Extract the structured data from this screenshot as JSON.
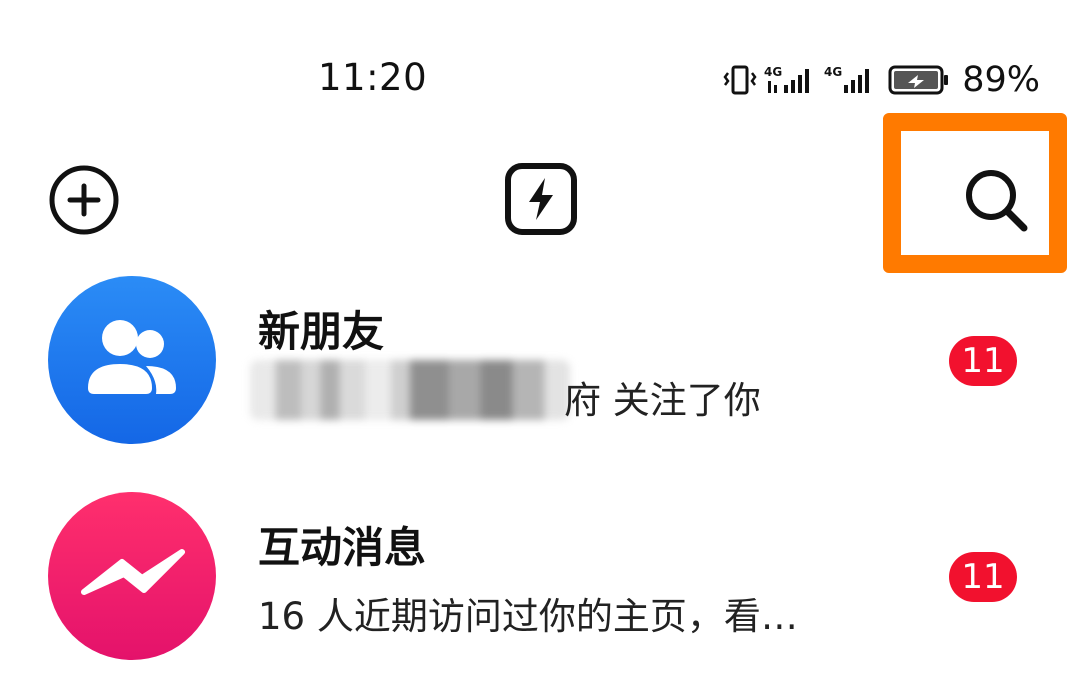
{
  "status_bar": {
    "time": "11:20",
    "battery_percent": "89%",
    "network_1": "4G",
    "network_2": "4G",
    "icons": [
      "vibrate-icon",
      "signal-4g-icon",
      "signal-4g-icon",
      "battery-charging-icon"
    ]
  },
  "toolbar": {
    "left_icon": "add-circle-icon",
    "center_icon": "flash-icon",
    "right_icon": "search-icon"
  },
  "highlight": {
    "color": "#ff7a00",
    "target": "search-button"
  },
  "messages": [
    {
      "icon": "friends-icon",
      "color": "#1a78f0",
      "title": "新朋友",
      "subtitle_visible": "府 关注了你",
      "badge": "11"
    },
    {
      "icon": "messenger-bolt-icon",
      "color": "#f0206e",
      "title": "互动消息",
      "subtitle": "16 人近期访问过你的主页，看…",
      "badge": "11"
    }
  ],
  "colors": {
    "badge": "#f2112e",
    "blue_avatar": "#1a78f0",
    "pink_avatar": "#f0206e"
  }
}
